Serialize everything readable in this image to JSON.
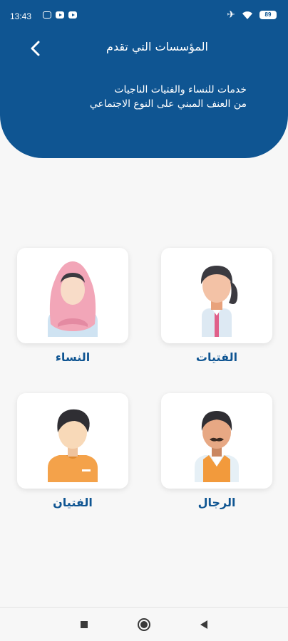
{
  "status_bar": {
    "time": "13:43",
    "battery": "89"
  },
  "header": {
    "title": "المؤسسات التي تقدم",
    "subtitle_line1": "خدمات للنساء والفتيات الناجيات",
    "subtitle_line2": "من العنف المبني على النوع الاجتماعي",
    "bg_color": "#0f5592"
  },
  "categories": [
    {
      "label": "الفتيات",
      "icon": "girl-icon"
    },
    {
      "label": "النساء",
      "icon": "woman-hijab-icon"
    },
    {
      "label": "الرجال",
      "icon": "man-mustache-icon"
    },
    {
      "label": "الفتيان",
      "icon": "boy-icon"
    }
  ],
  "nav": {
    "icons": [
      "recent-apps-icon",
      "home-icon",
      "back-icon"
    ]
  }
}
